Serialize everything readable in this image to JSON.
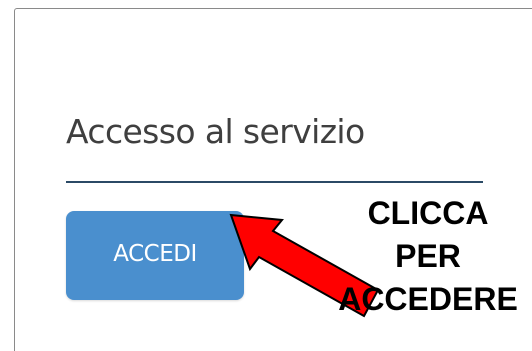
{
  "section": {
    "title": "Accesso al servizio"
  },
  "login": {
    "button_label": "ACCEDI"
  },
  "annotation": {
    "lines": [
      "CLICCA",
      "PER",
      "ACCEDERE"
    ],
    "arrow_color": "#ff0000",
    "arrow_outline": "#000000"
  },
  "colors": {
    "button_bg": "#4a8fce",
    "divider": "#2b4a66",
    "title_text": "#3f3f3f"
  }
}
